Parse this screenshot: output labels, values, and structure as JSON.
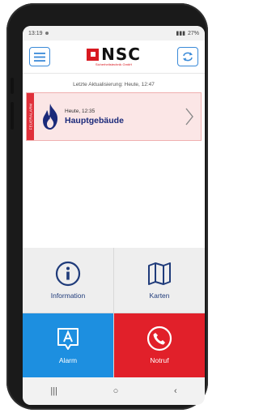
{
  "status_bar": {
    "time": "13:19",
    "battery": "27%"
  },
  "header": {
    "menu_icon": "hamburger-menu-icon",
    "logo_text": "NSC",
    "logo_subtitle": "Sicherheitstechnik GmbH",
    "refresh_icon": "refresh-icon"
  },
  "last_update": "Letzte Aktualisierung: Heute, 12:47",
  "alert": {
    "strip_label": "FEUERALARM",
    "time": "Heute, 12:35",
    "building": "Hauptgebäude",
    "icon": "flame-icon"
  },
  "tiles": [
    {
      "label": "Information",
      "icon": "info-icon",
      "color": "#eeeeee"
    },
    {
      "label": "Karten",
      "icon": "map-icon",
      "color": "#eeeeee"
    },
    {
      "label": "Alarm",
      "icon": "alarm-icon",
      "color": "#1d8fe0"
    },
    {
      "label": "Notruf",
      "icon": "phone-icon",
      "color": "#e1202a"
    }
  ],
  "nav": {
    "recents": "|||",
    "home": "○",
    "back": "‹"
  }
}
